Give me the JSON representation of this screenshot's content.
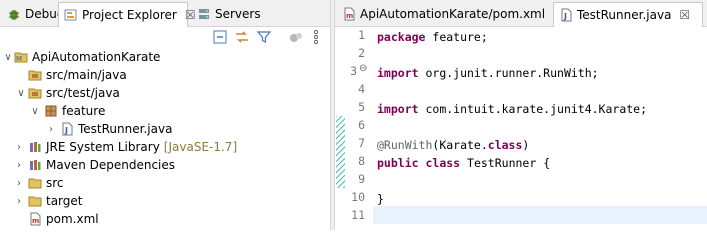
{
  "left_panel": {
    "tabs": [
      {
        "label": "Debug"
      },
      {
        "label": "Project Explorer",
        "close": "☒"
      },
      {
        "label": "Servers"
      }
    ],
    "toolbar_icons": [
      "collapse-all-icon",
      "link-with-editor-icon",
      "filter-icon",
      "view-menu-icon"
    ],
    "tree": [
      {
        "label": "ApiAutomationKarate",
        "icon": "maven-project-icon",
        "expanded": true
      },
      {
        "label": "src/main/java",
        "icon": "package-folder-icon"
      },
      {
        "label": "src/test/java",
        "icon": "package-folder-icon",
        "expanded": true
      },
      {
        "label": "feature",
        "icon": "package-icon",
        "expanded": true
      },
      {
        "label": "TestRunner.java",
        "icon": "java-file-icon",
        "collapsed": true
      },
      {
        "label": "JRE System Library",
        "suffix": "[JavaSE-1.7]",
        "icon": "library-icon",
        "collapsed": true
      },
      {
        "label": "Maven Dependencies",
        "icon": "library-icon",
        "collapsed": true
      },
      {
        "label": "src",
        "icon": "folder-icon",
        "collapsed": true
      },
      {
        "label": "target",
        "icon": "folder-icon",
        "collapsed": true
      },
      {
        "label": "pom.xml",
        "icon": "xml-file-icon"
      }
    ]
  },
  "editor": {
    "tabs": [
      {
        "label": "ApiAutomationKarate/pom.xml"
      },
      {
        "label": "TestRunner.java",
        "close": "☒",
        "active": true
      }
    ],
    "line_numbers": [
      "1",
      "2",
      "3",
      "4",
      "5",
      "6",
      "7",
      "8",
      "9",
      "10",
      "11"
    ],
    "fold_marker": "⊖",
    "lines": [
      {
        "parts": [
          {
            "t": "package",
            "c": "kw"
          },
          {
            "t": " feature;",
            "c": ""
          }
        ]
      },
      {
        "parts": []
      },
      {
        "parts": [
          {
            "t": "import",
            "c": "kw"
          },
          {
            "t": " org.junit.runner.RunWith;",
            "c": ""
          }
        ]
      },
      {
        "parts": []
      },
      {
        "parts": [
          {
            "t": "import",
            "c": "kw"
          },
          {
            "t": " com.intuit.karate.junit4.Karate;",
            "c": ""
          }
        ]
      },
      {
        "parts": []
      },
      {
        "parts": [
          {
            "t": "@RunWith",
            "c": "ann"
          },
          {
            "t": "(Karate.",
            "c": ""
          },
          {
            "t": "class",
            "c": "kw"
          },
          {
            "t": ")",
            "c": ""
          }
        ]
      },
      {
        "parts": [
          {
            "t": "public",
            "c": "kw"
          },
          {
            "t": " ",
            "c": ""
          },
          {
            "t": "class",
            "c": "kw"
          },
          {
            "t": " TestRunner {",
            "c": ""
          }
        ]
      },
      {
        "parts": []
      },
      {
        "parts": [
          {
            "t": "}",
            "c": ""
          }
        ]
      },
      {
        "parts": []
      }
    ]
  }
}
